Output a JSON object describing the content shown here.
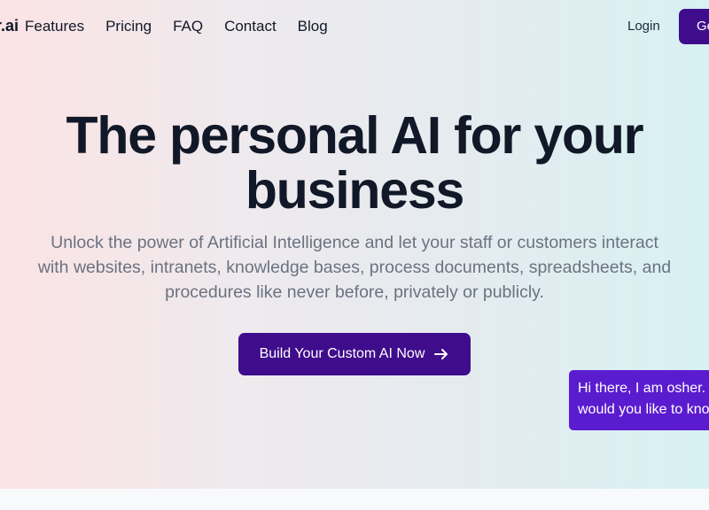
{
  "brand": {
    "logo_text": "r.ai"
  },
  "nav": {
    "links": [
      "Features",
      "Pricing",
      "FAQ",
      "Contact",
      "Blog"
    ],
    "login_label": "Login",
    "get_started_label": "Get Started"
  },
  "hero": {
    "headline_line1": "The personal AI for your",
    "headline_line2": "business",
    "subtitle_line1": "Unlock the power of Artificial Intelligence and let your staff or customers interact",
    "subtitle_line2": "with websites, intranets, knowledge bases, process documents, spreadsheets, and",
    "subtitle_line3": "procedures like never before, privately or publicly.",
    "cta_label": "Build Your Custom AI Now",
    "cta_icon": "arrow-right-icon"
  },
  "chat": {
    "line1": "Hi there, I am osher. What",
    "line2": "would you like to know?"
  },
  "colors": {
    "brand_purple": "#3f0d8c",
    "chat_purple": "#5b1ccf",
    "text_dark": "#111827",
    "text_muted": "#6b7280"
  }
}
